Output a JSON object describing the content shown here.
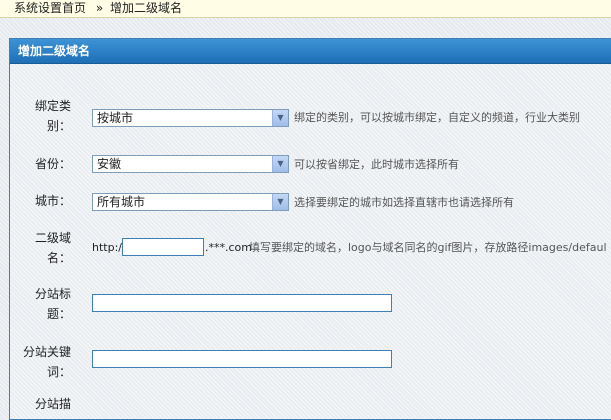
{
  "breadcrumb": {
    "home": "系统设置首页",
    "separator": "»",
    "current": "增加二级域名"
  },
  "panel": {
    "title": "增加二级域名"
  },
  "form": {
    "bind_type": {
      "label_line1": "绑定类",
      "label_line2": "别：",
      "value": "按城市",
      "hint": "绑定的类别，可以按城市绑定，自定义的频道，行业大类别"
    },
    "province": {
      "label": "省份：",
      "value": "安徽",
      "hint": "可以按省绑定，此时城市选择所有"
    },
    "city": {
      "label": "城市：",
      "value": "所有城市",
      "hint": "选择要绑定的城市如选择直辖市也请选择所有"
    },
    "subdomain": {
      "label_line1": "二级域",
      "label_line2": "名：",
      "prefix": "http://",
      "value": "",
      "suffix": ".***.com",
      "hint": "填写要绑定的域名，logo与域名同名的gif图片，存放路径images/defaul"
    },
    "site_title": {
      "label_line1": "分站标",
      "label_line2": "题：",
      "value": ""
    },
    "site_keywords": {
      "label_line1": "分站关键",
      "label_line2": "词：",
      "value": ""
    },
    "site_desc": {
      "label_line1": "分站描"
    }
  },
  "colors": {
    "accent": "#1e6fb6",
    "border": "#3d7fb6",
    "breadcrumb_bg": "#fffde6"
  }
}
